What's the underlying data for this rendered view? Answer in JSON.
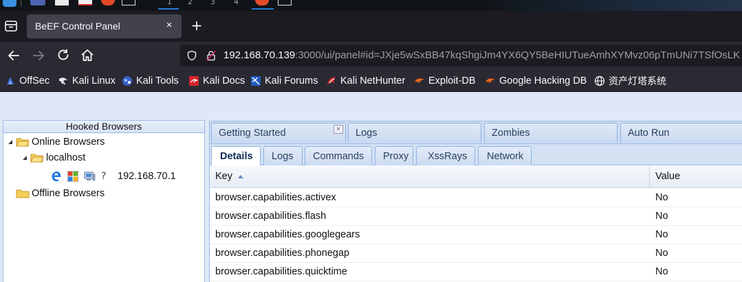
{
  "system_bar": {
    "workspaces": [
      "1",
      "2",
      "3",
      "4"
    ]
  },
  "browser": {
    "tab_title": "BeEF Control Panel",
    "tab_close": "×",
    "new_tab": "+",
    "url_host": "192.168.70.139",
    "url_rest": ":3000/ui/panel#id=JXje5wSxBB47kqShgiJm4YX6QY5BeHIUTueAmhXYMvz06pTmUNi7TSfOsLK"
  },
  "bookmarks": [
    {
      "label": "OffSec",
      "icon": "offsec-icon"
    },
    {
      "label": "Kali Linux",
      "icon": "kali-dragon-icon"
    },
    {
      "label": "Kali Tools",
      "icon": "kali-tools-icon"
    },
    {
      "label": "Kali Docs",
      "icon": "kali-docs-icon"
    },
    {
      "label": "Kali Forums",
      "icon": "kali-forums-icon"
    },
    {
      "label": "Kali NetHunter",
      "icon": "nethunter-icon"
    },
    {
      "label": "Exploit-DB",
      "icon": "exploit-db-icon"
    },
    {
      "label": "Google Hacking DB",
      "icon": "ghdb-icon"
    },
    {
      "label": "资产灯塔系统",
      "icon": "globe-icon"
    }
  ],
  "hooked_browsers": {
    "title": "Hooked Browsers",
    "online_label": "Online Browsers",
    "host_label": "localhost",
    "browser_ip": "192.168.70.1",
    "offline_label": "Offline Browsers"
  },
  "top_tabs": [
    "Getting Started",
    "Logs",
    "Zombies",
    "Auto Run"
  ],
  "top_tab_close": "×",
  "sub_tabs": [
    "Details",
    "Logs",
    "Commands",
    "Proxy",
    "XssRays",
    "Network"
  ],
  "grid": {
    "key_header": "Key",
    "value_header": "Value",
    "rows": [
      {
        "key": "browser.capabilities.activex",
        "value": "No"
      },
      {
        "key": "browser.capabilities.flash",
        "value": "No"
      },
      {
        "key": "browser.capabilities.googlegears",
        "value": "No"
      },
      {
        "key": "browser.capabilities.phonegap",
        "value": "No"
      },
      {
        "key": "browser.capabilities.quicktime",
        "value": "No"
      }
    ]
  },
  "colors": {
    "browser_chrome": "#2b2a33",
    "tab_bar": "#1c1b22",
    "ext_panel_bg": "#dfe8f6",
    "ext_border": "#99bbe8"
  }
}
